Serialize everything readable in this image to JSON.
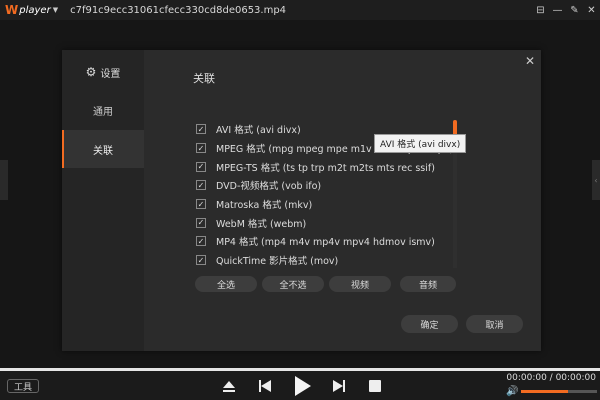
{
  "app": {
    "logo_w": "W",
    "logo_text": "player",
    "filename": "c7f91c9ecc31061cfecc330cd8de0653.mp4"
  },
  "window_controls": [
    "pin-icon",
    "minimize-icon",
    "edit-icon",
    "close-icon"
  ],
  "dialog": {
    "settings_label": "设置",
    "nav": [
      {
        "label": "通用"
      },
      {
        "label": "关联",
        "active": true
      }
    ],
    "section_title": "关联",
    "associations": [
      {
        "label": "AVI 格式 (avi divx)",
        "checked": true
      },
      {
        "label": "MPEG 格式 (mpg mpeg mpe m1v m2v mp2v mpv)",
        "checked": true
      },
      {
        "label": "MPEG-TS 格式 (ts tp trp m2t m2ts mts rec ssif)",
        "checked": true
      },
      {
        "label": "DVD-视频格式 (vob ifo)",
        "checked": true
      },
      {
        "label": "Matroska 格式 (mkv)",
        "checked": true
      },
      {
        "label": "WebM 格式 (webm)",
        "checked": true
      },
      {
        "label": "MP4 格式 (mp4 m4v mp4v mpv4 hdmov ismv)",
        "checked": true
      },
      {
        "label": "QuickTime 影片格式 (mov)",
        "checked": true
      }
    ],
    "tooltip": "AVI 格式 (avi divx)",
    "select_buttons": [
      "全选",
      "全不选",
      "视频",
      "音频"
    ],
    "ok_label": "确定",
    "cancel_label": "取消"
  },
  "bottom": {
    "tools_label": "工具",
    "time": "00:00:00 / 00:00:00",
    "volume_fraction": 0.62
  },
  "colors": {
    "accent": "#f26b21"
  }
}
